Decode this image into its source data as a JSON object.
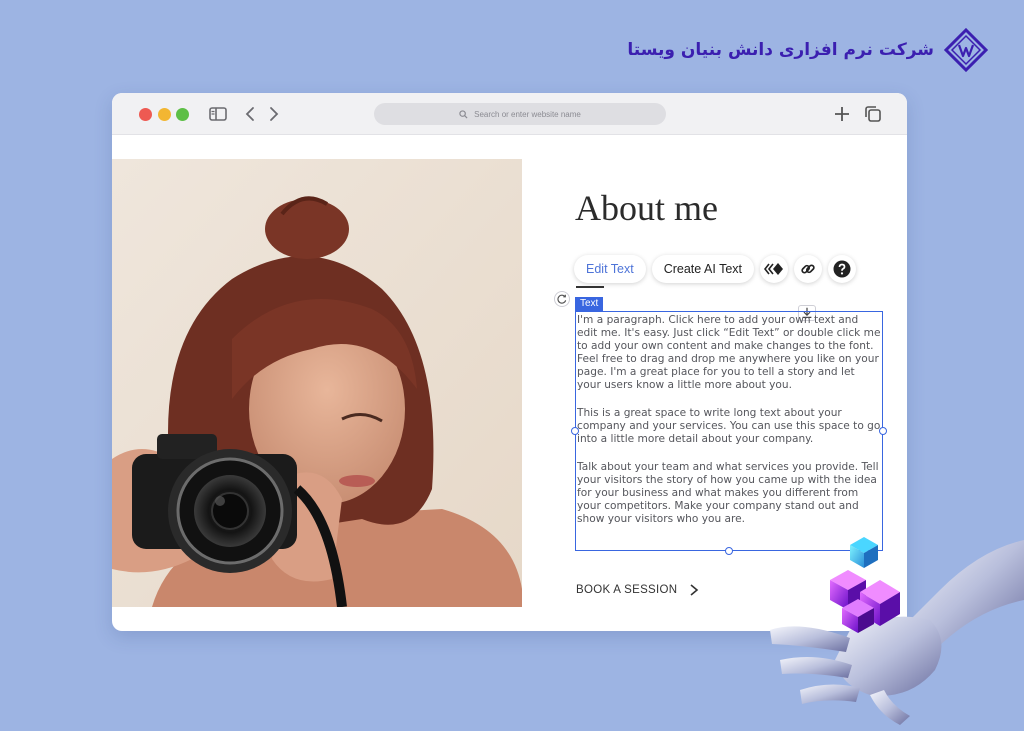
{
  "brand": {
    "name": "شرکت نرم افزاری دانش بنیان ویستا"
  },
  "browser": {
    "address_placeholder": "Search or enter website name",
    "icons": [
      "sidebar-icon",
      "back-icon",
      "forward-icon",
      "plus-icon",
      "tabs-icon",
      "search-icon"
    ]
  },
  "page": {
    "heading": "About me",
    "toolbar": {
      "edit_text": "Edit Text",
      "create_ai_text": "Create AI Text"
    },
    "selection_tag": "Text",
    "paragraphs": [
      "I'm a paragraph. Click here to add your own text and edit me. It's easy. Just click “Edit Text” or double click me to add your own content and make changes to the font. Feel free to drag and drop me anywhere you like on your page. I'm a great place for you to tell a story and let your users know a little more about you.",
      "This is a great space to write long text about your company and your services. You can use this space to go into a little more detail about your company.",
      "Talk about your team and what services you provide. Tell your visitors the story of how you came up with the idea for your business and what makes you different from your competitors. Make your company stand out and show your visitors who you are."
    ],
    "cta": "BOOK A SESSION"
  },
  "colors": {
    "background": "#9db4e3",
    "brand": "#3b1fb0",
    "selection": "#3966e0",
    "active_toolbar": "#4e74d8"
  }
}
